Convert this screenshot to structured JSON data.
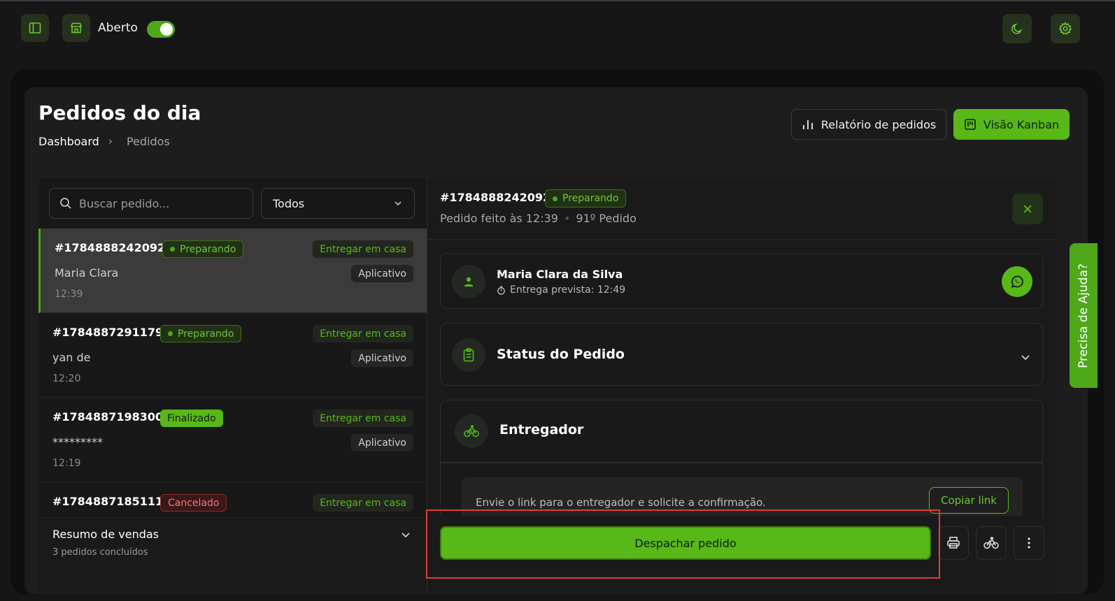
{
  "topbar": {
    "store_status_label": "Aberto",
    "store_open": true
  },
  "header": {
    "title": "Pedidos do dia",
    "breadcrumb": [
      "Dashboard",
      "Pedidos"
    ],
    "report_button": "Relatório de pedidos",
    "kanban_button": "Visão Kanban"
  },
  "list": {
    "search_placeholder": "Buscar pedido...",
    "filter_value": "Todos",
    "orders": [
      {
        "id": "#1784888242092",
        "status": "Preparando",
        "delivery": "Entregar em casa",
        "customer": "Maria Clara",
        "source": "Aplicativo",
        "time": "12:39"
      },
      {
        "id": "#1784887291179",
        "status": "Preparando",
        "delivery": "Entregar em casa",
        "customer": "yan de",
        "source": "Aplicativo",
        "time": "12:20"
      },
      {
        "id": "#1784887198300",
        "status": "Finalizado",
        "delivery": "Entregar em casa",
        "customer": "*********",
        "source": "Aplicativo",
        "time": "12:19"
      },
      {
        "id": "#1784887185111",
        "status": "Cancelado",
        "delivery": "Entregar em casa"
      }
    ],
    "summary": {
      "title": "Resumo de vendas",
      "subtitle": "3 pedidos concluídos"
    }
  },
  "detail": {
    "id": "#1784888242092",
    "status": "Preparando",
    "placed_at": "Pedido feito às 12:39",
    "order_count": "91º Pedido",
    "customer": {
      "name": "Maria Clara da Silva",
      "eta": "Entrega prevista: 12:49"
    },
    "status_section": "Status do Pedido",
    "courier_section": "Entregador",
    "courier_hint": "Envie o link para o entregador e solicite a confirmação.",
    "copy_link": "Copiar link",
    "dispatch_button": "Despachar pedido"
  },
  "help_tab": "Precisa de Ajuda?",
  "colors": {
    "accent": "#58b817",
    "background": "#161616",
    "highlight": "#e23b3b"
  }
}
